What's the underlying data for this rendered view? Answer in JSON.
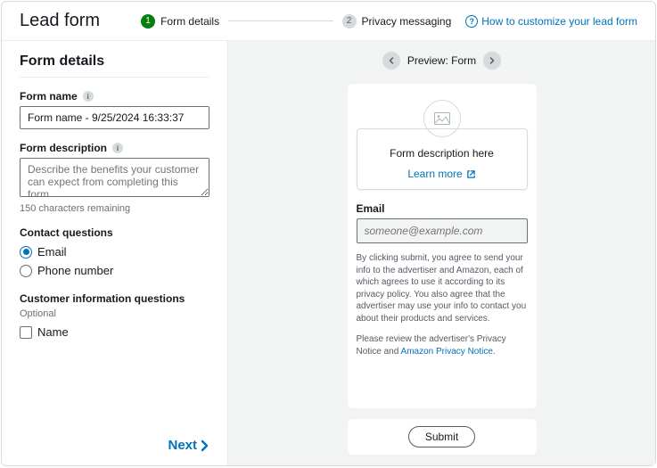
{
  "header": {
    "title": "Lead form",
    "steps": [
      {
        "num": "1",
        "label": "Form details"
      },
      {
        "num": "2",
        "label": "Privacy messaging"
      }
    ],
    "help_link": "How to customize your lead form"
  },
  "left": {
    "section_title": "Form details",
    "form_name_label": "Form name",
    "form_name_value": "Form name - 9/25/2024 16:33:37",
    "form_desc_label": "Form description",
    "form_desc_placeholder": "Describe the benefits your customer can expect from completing this form.",
    "char_remaining": "150 characters remaining",
    "contact_q_label": "Contact questions",
    "contact_options": [
      "Email",
      "Phone number"
    ],
    "customer_q_label": "Customer information questions",
    "optional_text": "Optional",
    "customer_options": [
      "Name"
    ],
    "next_label": "Next"
  },
  "preview": {
    "bar_label": "Preview: Form",
    "desc_text": "Form description here",
    "learn_more": "Learn more",
    "email_label": "Email",
    "email_placeholder": "someone@example.com",
    "disclaimer1": "By clicking submit, you agree to send your info to the advertiser and Amazon, each of which agrees to use it according to its privacy policy. You also agree that the advertiser may use your info to contact you about their products and services.",
    "disclaimer2_pre": "Please review the advertiser's Privacy Notice and ",
    "disclaimer2_link": "Amazon Privacy Notice",
    "disclaimer2_post": ".",
    "submit_label": "Submit"
  }
}
